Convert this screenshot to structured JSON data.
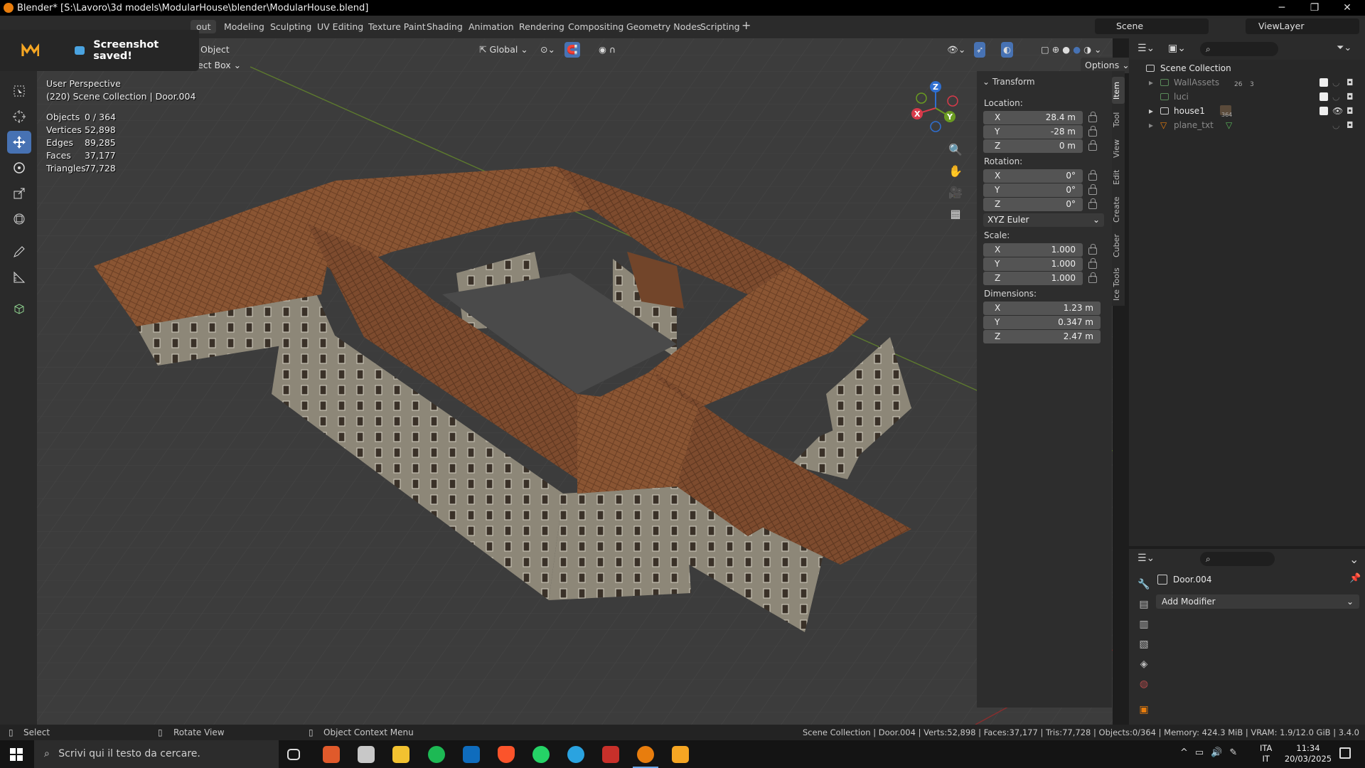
{
  "window": {
    "title": "Blender* [S:\\Lavoro\\3d models\\ModularHouse\\blender\\ModularHouse.blend]"
  },
  "workspaces": [
    "Layout",
    "Modeling",
    "Sculpting",
    "UV Editing",
    "Texture Paint",
    "Shading",
    "Animation",
    "Rendering",
    "Compositing",
    "Geometry Nodes",
    "Scripting"
  ],
  "workspace_active_visible": "out",
  "scene": {
    "name": "Scene",
    "view_layer": "ViewLayer"
  },
  "toast": {
    "message": "Screenshot saved!"
  },
  "viewport_header": {
    "menu_object": "Object",
    "select_mode": "ect Box",
    "transform_orientation": "Global",
    "options_label": "Options"
  },
  "overlay": {
    "perspective": "User Perspective",
    "context": "(220) Scene Collection | Door.004",
    "stats": [
      {
        "label": "Objects",
        "value": "0 / 364"
      },
      {
        "label": "Vertices",
        "value": "52,898"
      },
      {
        "label": "Edges",
        "value": "89,285"
      },
      {
        "label": "Faces",
        "value": "37,177"
      },
      {
        "label": "Triangles",
        "value": "77,728"
      }
    ]
  },
  "n_panel": {
    "section": "Transform",
    "location_label": "Location:",
    "location": [
      {
        "axis": "X",
        "value": "28.4 m"
      },
      {
        "axis": "Y",
        "value": "-28 m"
      },
      {
        "axis": "Z",
        "value": "0 m"
      }
    ],
    "rotation_label": "Rotation:",
    "rotation": [
      {
        "axis": "X",
        "value": "0°"
      },
      {
        "axis": "Y",
        "value": "0°"
      },
      {
        "axis": "Z",
        "value": "0°"
      }
    ],
    "rotation_mode": "XYZ Euler",
    "scale_label": "Scale:",
    "scale": [
      {
        "axis": "X",
        "value": "1.000"
      },
      {
        "axis": "Y",
        "value": "1.000"
      },
      {
        "axis": "Z",
        "value": "1.000"
      }
    ],
    "dimensions_label": "Dimensions:",
    "dimensions": [
      {
        "axis": "X",
        "value": "1.23 m"
      },
      {
        "axis": "Y",
        "value": "0.347 m"
      },
      {
        "axis": "Z",
        "value": "2.47 m"
      }
    ],
    "tabs": [
      "Item",
      "Tool",
      "View",
      "Edit",
      "Create",
      "Cuber",
      "Ice Tools"
    ]
  },
  "gizmo_axes": [
    "X",
    "Y",
    "Z"
  ],
  "outliner": {
    "root": "Scene Collection",
    "items": [
      {
        "name": "WallAssets",
        "badge1": "26",
        "badge2": "3"
      },
      {
        "name": "luci",
        "badge1": "",
        "badge2": ""
      },
      {
        "name": "house1",
        "badge1": "364",
        "badge2": ""
      },
      {
        "name": "plane_txt",
        "badge1": "",
        "badge2": ""
      }
    ]
  },
  "properties": {
    "object_name": "Door.004",
    "add_modifier": "Add Modifier"
  },
  "statusbar": {
    "left": "Select",
    "middle": "Rotate View",
    "right_action": "Object Context Menu",
    "info": "Scene Collection | Door.004 | Verts:52,898 | Faces:37,177 | Tris:77,728 | Objects:0/364 | Memory: 424.3 MiB | VRAM: 1.9/12.0 GiB | 3.4.0"
  },
  "taskbar": {
    "search_placeholder": "Scrivi qui il testo da cercare.",
    "lang1": "ITA",
    "lang2": "IT",
    "time": "11:34",
    "date": "20/03/2025"
  },
  "colors": {
    "accent": "#4772b3",
    "viewport": "#3c3c3c",
    "roof": "#8a5533",
    "wall": "#8d8778"
  }
}
